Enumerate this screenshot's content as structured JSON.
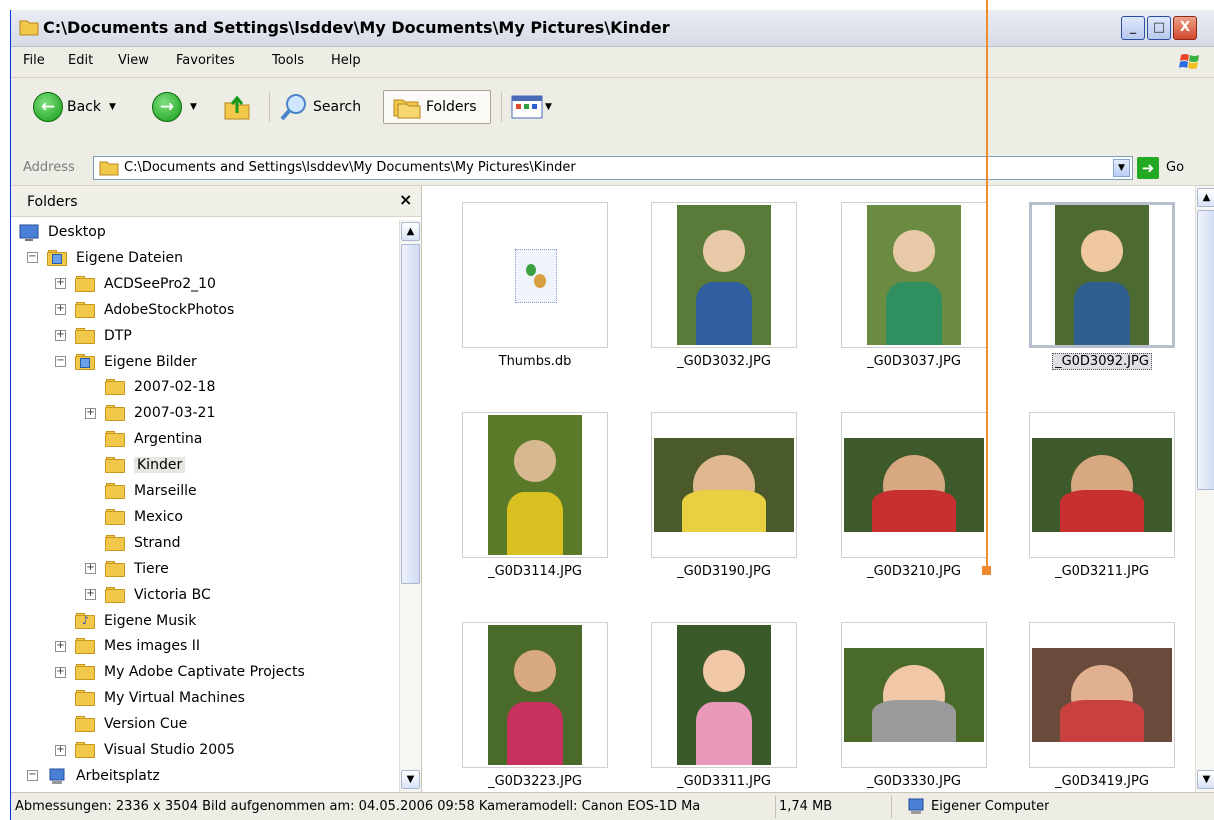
{
  "window": {
    "title": "C:\\Documents and Settings\\lsddev\\My Documents\\My Pictures\\Kinder",
    "controls": {
      "minimize": "_",
      "maximize": "□",
      "close": "X"
    }
  },
  "menu": {
    "items": [
      {
        "label": "File"
      },
      {
        "label": "Edit"
      },
      {
        "label": "View"
      },
      {
        "label": "Favorites"
      },
      {
        "label": "Tools"
      },
      {
        "label": "Help"
      }
    ],
    "logo_icon": "windows-flag-icon"
  },
  "toolbar": {
    "back_label": "Back",
    "search_label": "Search",
    "folders_label": "Folders",
    "icons": [
      "back-arrow-icon",
      "forward-arrow-icon",
      "up-folder-icon",
      "search-magnifier-icon",
      "folders-icon",
      "views-icon"
    ]
  },
  "address": {
    "label": "Address",
    "value": "C:\\Documents and Settings\\lsddev\\My Documents\\My Pictures\\Kinder",
    "go_label": "Go"
  },
  "folders_pane": {
    "title": "Folders",
    "close": "×",
    "tree": [
      {
        "label": "Desktop",
        "level": 0,
        "expander": "",
        "icon": "desktop-icon"
      },
      {
        "label": "Eigene Dateien",
        "level": 1,
        "expander": "−",
        "icon": "documents-icon"
      },
      {
        "label": "ACDSeePro2_10",
        "level": 2,
        "expander": "+",
        "icon": "folder-icon"
      },
      {
        "label": "AdobeStockPhotos",
        "level": 2,
        "expander": "+",
        "icon": "folder-icon"
      },
      {
        "label": "DTP",
        "level": 2,
        "expander": "+",
        "icon": "folder-icon"
      },
      {
        "label": "Eigene Bilder",
        "level": 2,
        "expander": "−",
        "icon": "pictures-folder-icon"
      },
      {
        "label": "2007-02-18",
        "level": 3,
        "expander": "",
        "icon": "folder-icon"
      },
      {
        "label": "2007-03-21",
        "level": 3,
        "expander": "+",
        "icon": "folder-icon"
      },
      {
        "label": "Argentina",
        "level": 3,
        "expander": "",
        "icon": "folder-icon"
      },
      {
        "label": "Kinder",
        "level": 3,
        "expander": "",
        "icon": "folder-icon",
        "selected": true
      },
      {
        "label": "Marseille",
        "level": 3,
        "expander": "",
        "icon": "folder-icon"
      },
      {
        "label": "Mexico",
        "level": 3,
        "expander": "",
        "icon": "folder-icon"
      },
      {
        "label": "Strand",
        "level": 3,
        "expander": "",
        "icon": "folder-icon"
      },
      {
        "label": "Tiere",
        "level": 3,
        "expander": "+",
        "icon": "folder-icon"
      },
      {
        "label": "Victoria BC",
        "level": 3,
        "expander": "+",
        "icon": "folder-icon"
      },
      {
        "label": "Eigene Musik",
        "level": 2,
        "expander": "",
        "icon": "music-folder-icon"
      },
      {
        "label": "Mes images II",
        "level": 2,
        "expander": "+",
        "icon": "folder-icon"
      },
      {
        "label": "My Adobe Captivate Projects",
        "level": 2,
        "expander": "+",
        "icon": "folder-icon"
      },
      {
        "label": "My Virtual Machines",
        "level": 2,
        "expander": "",
        "icon": "folder-icon"
      },
      {
        "label": "Version Cue",
        "level": 2,
        "expander": "",
        "icon": "folder-icon"
      },
      {
        "label": "Visual Studio 2005",
        "level": 2,
        "expander": "+",
        "icon": "folder-icon"
      },
      {
        "label": "Arbeitsplatz",
        "level": 1,
        "expander": "−",
        "icon": "computer-icon"
      }
    ]
  },
  "files": [
    {
      "name": "Thumbs.db",
      "kind": "file"
    },
    {
      "name": "_G0D3032.JPG",
      "kind": "photo-portrait",
      "colors": [
        "#5a7a3a",
        "#e8c9a8",
        "#2f5fa0"
      ]
    },
    {
      "name": "_G0D3037.JPG",
      "kind": "photo-portrait",
      "colors": [
        "#6b8a42",
        "#e8c9a8",
        "#2f8f5f"
      ]
    },
    {
      "name": "_G0D3092.JPG",
      "kind": "photo-portrait",
      "colors": [
        "#4d6a33",
        "#f0c8a0",
        "#2f5f8f"
      ],
      "selected": true
    },
    {
      "name": "_G0D3114.JPG",
      "kind": "photo-portrait",
      "colors": [
        "#5a7a2a",
        "#d8b890",
        "#d8c020"
      ]
    },
    {
      "name": "_G0D3190.JPG",
      "kind": "photo-landscape",
      "colors": [
        "#4a5a2a",
        "#e0b890",
        "#e8d040"
      ]
    },
    {
      "name": "_G0D3210.JPG",
      "kind": "photo-landscape",
      "colors": [
        "#3e5a2a",
        "#d8a880",
        "#c83030"
      ]
    },
    {
      "name": "_G0D3211.JPG",
      "kind": "photo-landscape",
      "colors": [
        "#3e5a2a",
        "#d8a880",
        "#c83030"
      ]
    },
    {
      "name": "_G0D3223.JPG",
      "kind": "photo-portrait",
      "colors": [
        "#4a6a2a",
        "#d8a880",
        "#c83060"
      ]
    },
    {
      "name": "_G0D3311.JPG",
      "kind": "photo-portrait",
      "colors": [
        "#3a5a2a",
        "#f0c8a8",
        "#e898b8"
      ]
    },
    {
      "name": "_G0D3330.JPG",
      "kind": "photo-landscape",
      "colors": [
        "#4a6a2a",
        "#f0c8a8",
        "#9a9a9a"
      ]
    },
    {
      "name": "_G0D3419.JPG",
      "kind": "photo-landscape",
      "colors": [
        "#6a4a3a",
        "#e0b090",
        "#c84040"
      ]
    }
  ],
  "status": {
    "info": "Abmessungen: 2336 x 3504 Bild aufgenommen am: 04.05.2006 09:58 Kameramodell: Canon EOS-1D Ma",
    "size": "1,74 MB",
    "location": "Eigener Computer"
  },
  "colors": {
    "annotation": "#f08a2e",
    "folder": "#f2c84a",
    "go": "#22a822"
  }
}
